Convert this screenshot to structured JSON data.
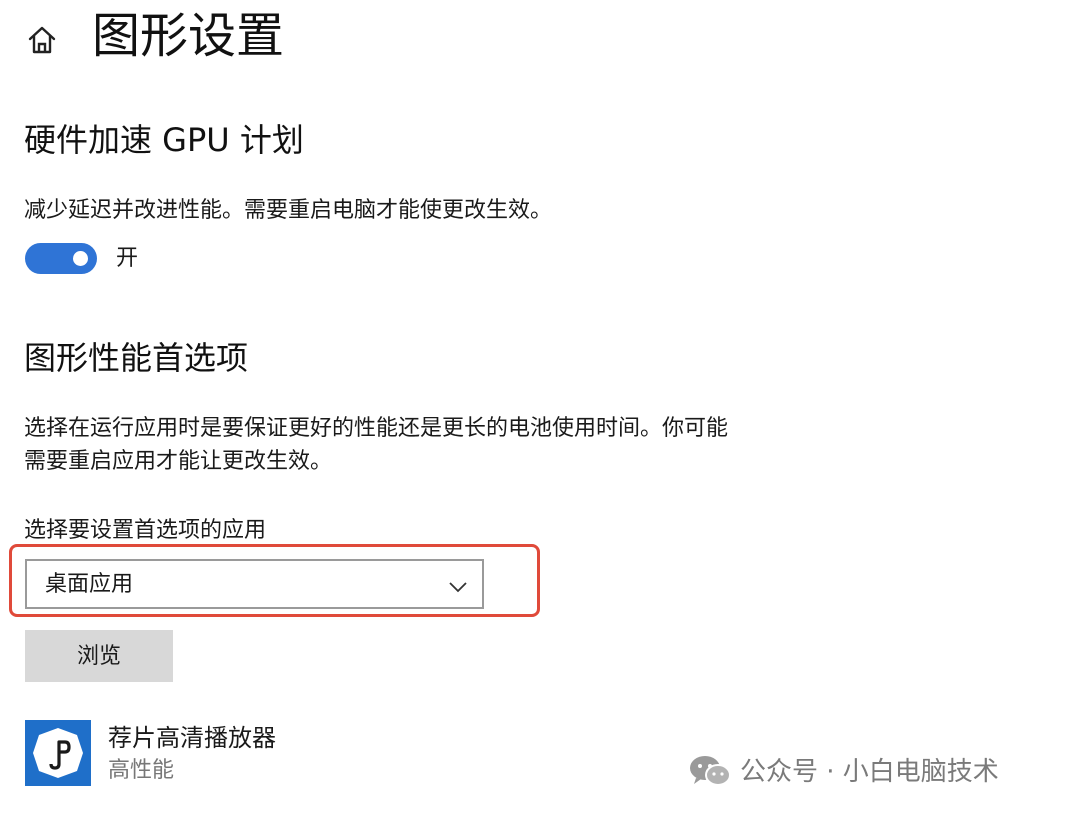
{
  "header": {
    "title": "图形设置",
    "home_icon": "home-icon"
  },
  "gpu_scheduling": {
    "title": "硬件加速 GPU 计划",
    "description": "减少延迟并改进性能。需要重启电脑才能使更改生效。",
    "toggle_state": "开",
    "toggle_on": true,
    "accent_color": "#2f74d6"
  },
  "graphics_preference": {
    "title": "图形性能首选项",
    "description_line1": "选择在运行应用时是要保证更好的性能还是更长的电池使用时间。你可能",
    "description_line2": "需要重启应用才能让更改生效。",
    "select_label": "选择要设置首选项的应用",
    "selected_app_type": "桌面应用",
    "browse_button": "浏览",
    "highlight_color": "#e04a3a"
  },
  "apps": [
    {
      "name": "荐片高清播放器",
      "preference": "高性能",
      "icon": "music-note-icon"
    }
  ],
  "watermark": {
    "text": "公众号 · 小白电脑技术",
    "icon": "wechat-icon"
  }
}
